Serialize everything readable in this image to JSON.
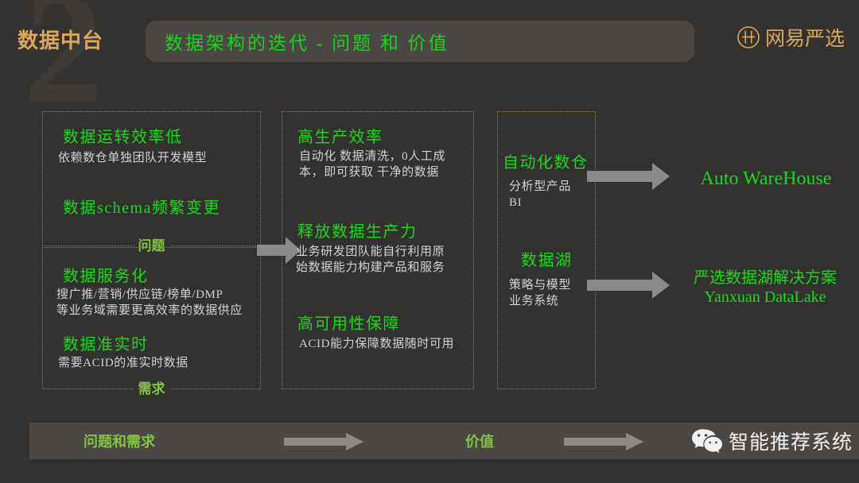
{
  "header": {
    "deck_title": "数据中台",
    "slide_title": "数据架构的迭代 - 问题 和 价值",
    "brand_name": "网易严选",
    "brand_icon": "yanxuan-circle-logo",
    "watermark": "2"
  },
  "colors": {
    "background": "#343230",
    "panel": "#4b4745",
    "heading_green": "#1ad81a",
    "tag_green": "#82c341",
    "brand_orange": "#dca756",
    "box_border": "#9a7a45",
    "body_text": "#d2d2d2",
    "arrow": "#8c8a88"
  },
  "columns": {
    "problems": {
      "tag": "问题",
      "items": [
        {
          "heading": "数据运转效率低",
          "body": "依赖数仓单独团队开发模型"
        },
        {
          "heading": "数据schema频繁变更",
          "body": ""
        }
      ]
    },
    "requirements": {
      "tag": "需求",
      "items": [
        {
          "heading": "数据服务化",
          "body": "搜广推/营销/供应链/榜单/DMP\n等业务域需要更高效率的数据供应"
        },
        {
          "heading": "数据准实时",
          "body": "需要ACID的准实时数据"
        }
      ]
    },
    "value": {
      "items": [
        {
          "heading": "高生产效率",
          "body": "自动化 数据清洗，0人工成\n本，即可获取 干净的数据"
        },
        {
          "heading": "释放数据生产力",
          "body": "业务研发团队能自行利用原\n始数据能力构建产品和服务"
        },
        {
          "heading": "高可用性保障",
          "body": "ACID能力保障数据随时可用"
        }
      ]
    },
    "products": {
      "items": [
        {
          "heading": "自动化数仓",
          "body": "分析型产品\nBI"
        },
        {
          "heading": "数据湖",
          "body": "策略与模型\n业务系统"
        }
      ]
    }
  },
  "outcomes": [
    {
      "lines": "Auto WareHouse"
    },
    {
      "lines": "严选数据湖解决方案\nYanxuan DataLake"
    }
  ],
  "footer": {
    "left_label": "问题和需求",
    "right_label": "价值",
    "wechat_icon": "wechat-icon",
    "wechat_text": "智能推荐系统"
  }
}
